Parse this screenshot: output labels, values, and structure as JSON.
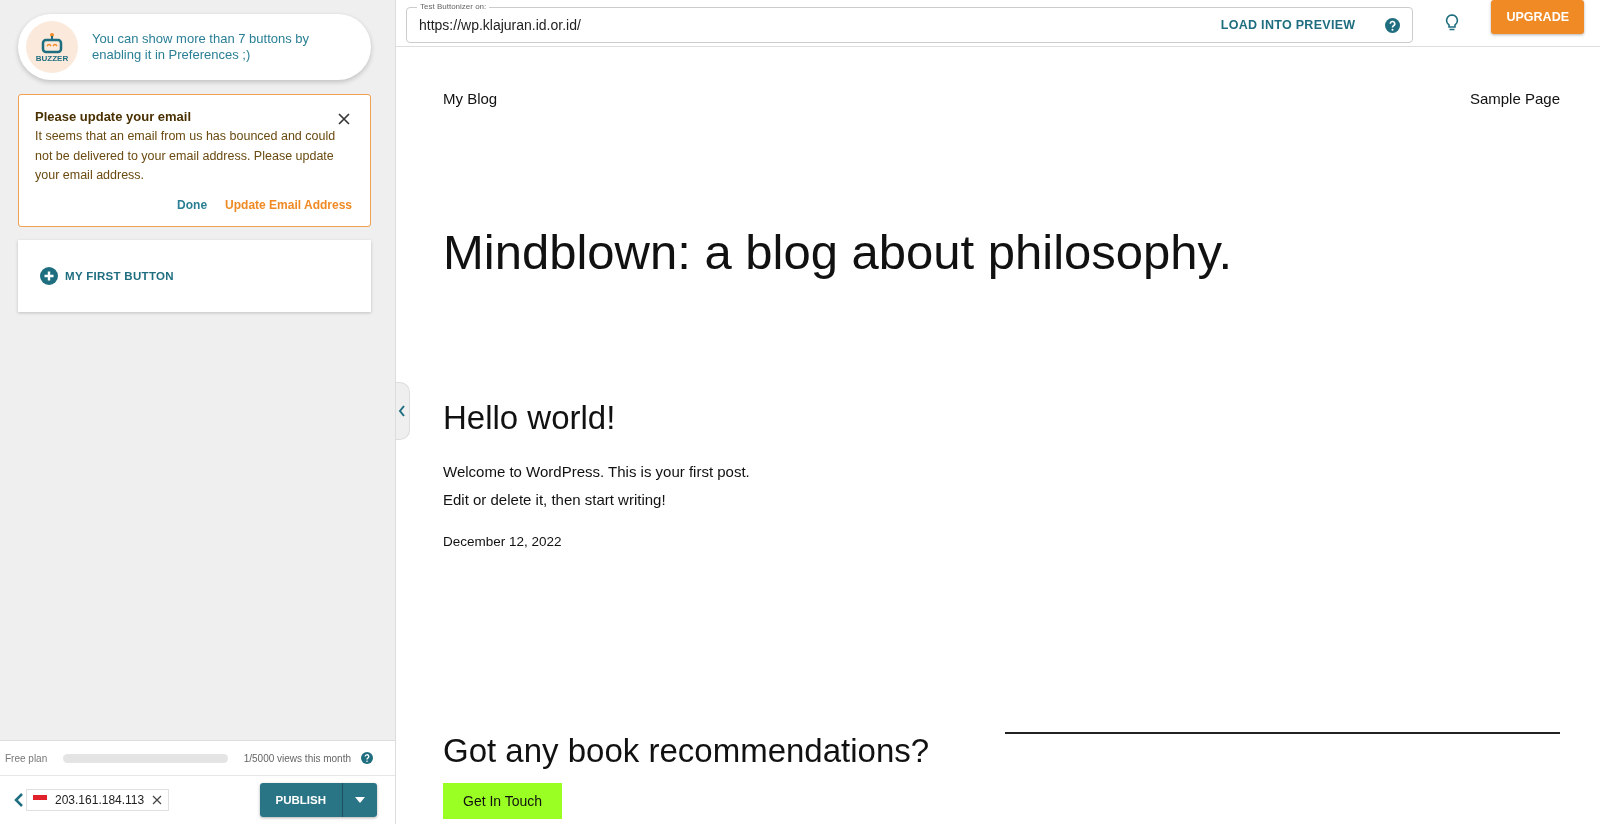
{
  "tip": {
    "logo": "BUZZER",
    "text": "You can show more than 7 buttons by enabling it in Preferences ;)"
  },
  "alert": {
    "title": "Please update your email",
    "body": "It seems that an email from us has bounced and could not be delivered to your email address. Please update your email address.",
    "actions": [
      "Done",
      "Update Email Address"
    ]
  },
  "buttons": [
    {
      "label": "MY FIRST BUTTON"
    }
  ],
  "plan": {
    "label": "Free plan",
    "level": 0.0002,
    "usage": "1/5000 views this month"
  },
  "footer": {
    "ip": "203.161.184.113",
    "publish": "PUBLISH"
  },
  "topbar": {
    "field_label": "Test Buttonizer on:",
    "url": "https://wp.klajuran.id.or.id/",
    "load": "LOAD INTO PREVIEW",
    "upgrade": "UPGRADE"
  },
  "preview": {
    "site_title": "My Blog",
    "nav": [
      "Sample Page"
    ],
    "tagline": "Mindblown: a blog about philosophy.",
    "post_title": "Hello world!",
    "post_lines": [
      "Welcome to WordPress. This is your first post.",
      "Edit or delete it, then start writing!"
    ],
    "date": "December 12, 2022",
    "cta_heading": "Got any book recommendations?",
    "cta_button": "Get In Touch"
  }
}
